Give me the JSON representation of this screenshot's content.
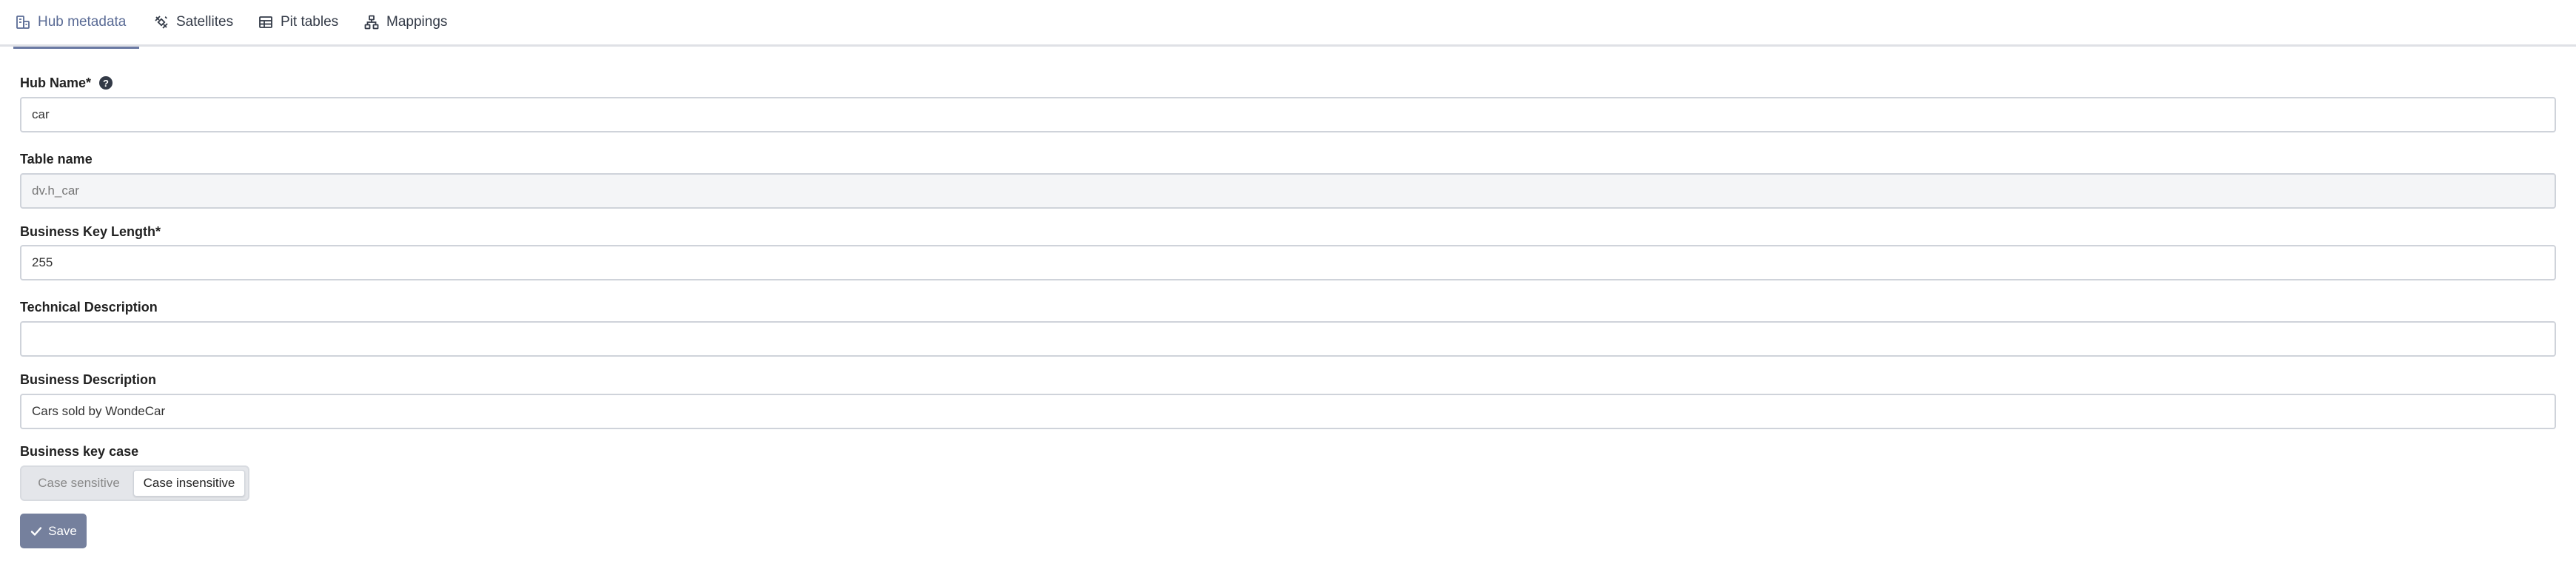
{
  "tabs": {
    "hub_metadata": {
      "label": "Hub metadata",
      "icon": "hub-metadata-icon",
      "active": true
    },
    "satellites": {
      "label": "Satellites",
      "icon": "satellites-icon"
    },
    "pit_tables": {
      "label": "Pit tables",
      "icon": "table-icon"
    },
    "mappings": {
      "label": "Mappings",
      "icon": "mappings-icon"
    }
  },
  "form": {
    "hub_name": {
      "label": "Hub Name*",
      "value": "car",
      "help_icon": "?"
    },
    "table_name": {
      "label": "Table name",
      "value": "dv.h_car"
    },
    "business_key_length": {
      "label": "Business Key Length*",
      "value": "255"
    },
    "technical_description": {
      "label": "Technical Description",
      "value": ""
    },
    "business_description": {
      "label": "Business Description",
      "value": "Cars sold by WondeCar"
    },
    "business_key_case": {
      "label": "Business key case",
      "options": [
        "Case sensitive",
        "Case insensitive"
      ],
      "selected": "Case insensitive"
    },
    "save_label": "Save"
  },
  "colors": {
    "accent": "#6b7aa3",
    "save_button": "#75809d",
    "border": "#cfd3da"
  }
}
